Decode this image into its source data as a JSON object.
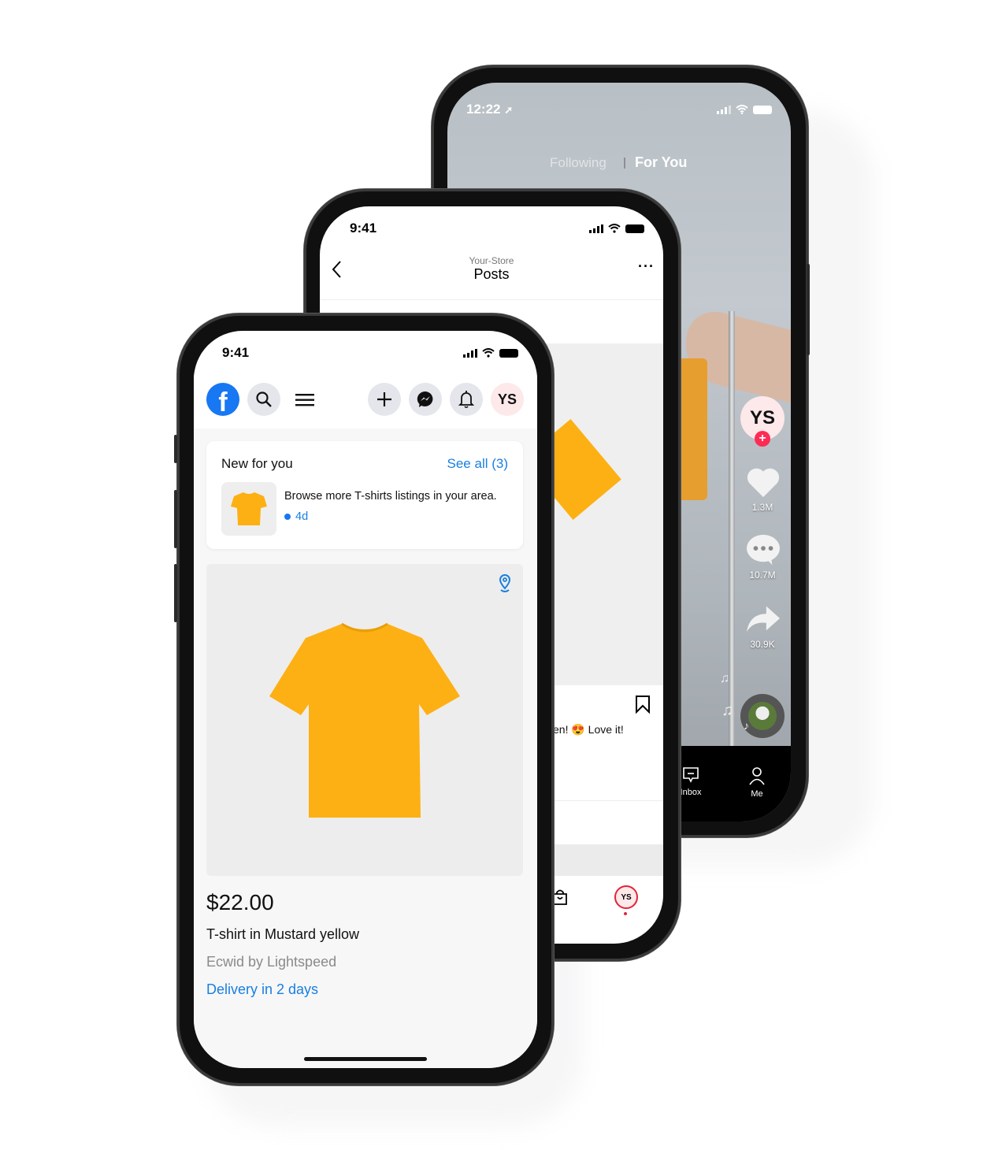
{
  "phone_back_tiktok": {
    "status": {
      "time": "12:22"
    },
    "tabs": {
      "following": "Following",
      "for_you": "For You"
    },
    "profile": {
      "initials": "YS"
    },
    "actions": {
      "likes": "1.3M",
      "comments": "10.7M",
      "shares": "30.9K"
    },
    "nav": {
      "inbox": "Inbox",
      "me": "Me"
    },
    "colors": {
      "follow_badge": "#fe2c55"
    }
  },
  "phone_middle_posts": {
    "status": {
      "time": "9:41"
    },
    "header": {
      "subtitle": "Your-Store",
      "title": "Posts"
    },
    "caption_fragment": "en! 😍 Love it!",
    "nav": {
      "profile_initials": "YS"
    }
  },
  "phone_front_facebook": {
    "status": {
      "time": "9:41"
    },
    "toolbar": {
      "profile_initials": "YS"
    },
    "notification_card": {
      "title": "New for you",
      "see_all": "See all (3)",
      "message": "Browse more T-shirts listings in your area.",
      "age": "4d"
    },
    "product": {
      "price": "$22.00",
      "name": "T-shirt in Mustard yellow",
      "seller": "Ecwid by Lightspeed",
      "delivery": "Delivery in 2 days"
    },
    "colors": {
      "brand": "#1877f2",
      "link": "#1a7fe0",
      "shirt": "#fdb013"
    }
  }
}
